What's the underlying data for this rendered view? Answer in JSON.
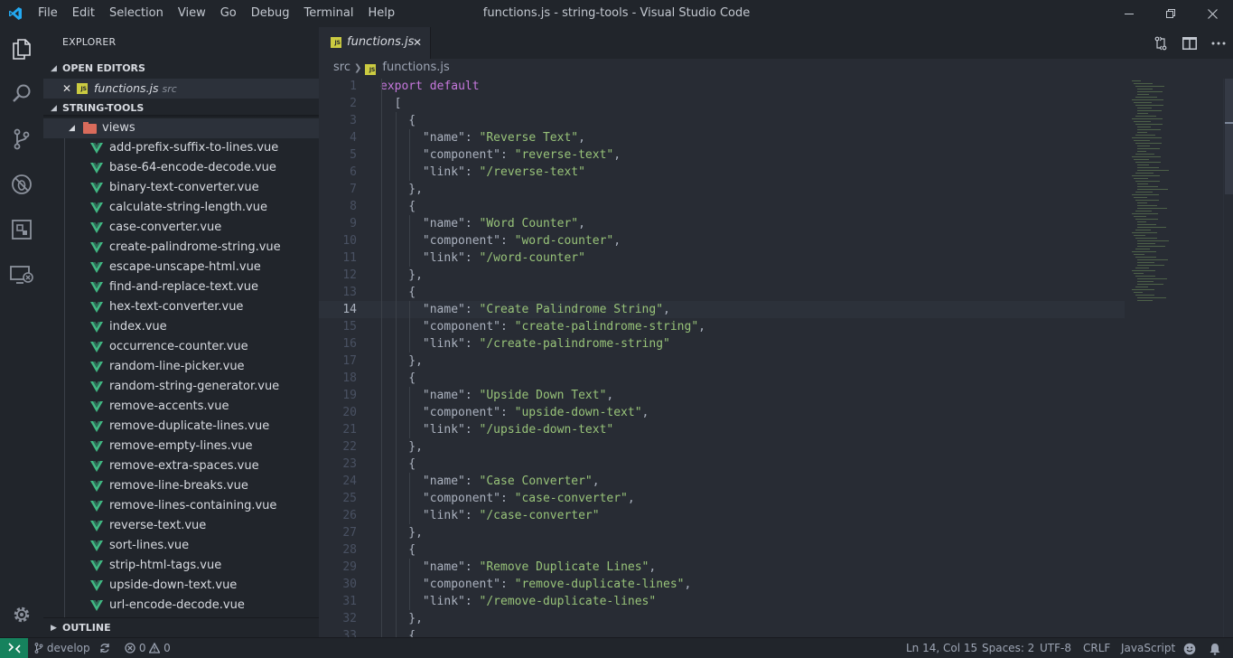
{
  "window": {
    "title": "functions.js - string-tools - Visual Studio Code",
    "menu": [
      "File",
      "Edit",
      "Selection",
      "View",
      "Go",
      "Debug",
      "Terminal",
      "Help"
    ]
  },
  "activity_bar": {
    "items": [
      "explorer-icon",
      "search-icon",
      "source-control-icon",
      "debug-icon",
      "extensions-icon",
      "remote-explorer-icon"
    ],
    "bottom": "settings-gear-icon"
  },
  "sidebar": {
    "title": "EXPLORER",
    "open_editors": {
      "header": "OPEN EDITORS",
      "items": [
        {
          "name": "functions.js",
          "path": "src"
        }
      ]
    },
    "project": {
      "header": "STRING-TOOLS",
      "folder": "views",
      "files": [
        "add-prefix-suffix-to-lines.vue",
        "base-64-encode-decode.vue",
        "binary-text-converter.vue",
        "calculate-string-length.vue",
        "case-converter.vue",
        "create-palindrome-string.vue",
        "escape-unscape-html.vue",
        "find-and-replace-text.vue",
        "hex-text-converter.vue",
        "index.vue",
        "occurrence-counter.vue",
        "random-line-picker.vue",
        "random-string-generator.vue",
        "remove-accents.vue",
        "remove-duplicate-lines.vue",
        "remove-empty-lines.vue",
        "remove-extra-spaces.vue",
        "remove-line-breaks.vue",
        "remove-lines-containing.vue",
        "reverse-text.vue",
        "sort-lines.vue",
        "strip-html-tags.vue",
        "upside-down-text.vue",
        "url-encode-decode.vue"
      ]
    },
    "outline_header": "OUTLINE"
  },
  "editor": {
    "tab": {
      "label": "functions.js",
      "badge": "JS"
    },
    "breadcrumb": [
      "src",
      "functions.js"
    ],
    "current_line": 14,
    "lines": [
      {
        "n": "1",
        "indent": 0,
        "tokens": [
          {
            "t": "kw",
            "v": "export default"
          }
        ]
      },
      {
        "n": "2",
        "indent": 1,
        "tokens": [
          {
            "t": "p",
            "v": "["
          }
        ]
      },
      {
        "n": "3",
        "indent": 2,
        "tokens": [
          {
            "t": "p",
            "v": "{"
          }
        ]
      },
      {
        "n": "4",
        "indent": 3,
        "tokens": [
          {
            "t": "p",
            "v": "\"name\": "
          },
          {
            "t": "s",
            "v": "\"Reverse Text\""
          },
          {
            "t": "p",
            "v": ","
          }
        ]
      },
      {
        "n": "5",
        "indent": 3,
        "tokens": [
          {
            "t": "p",
            "v": "\"component\": "
          },
          {
            "t": "s",
            "v": "\"reverse-text\""
          },
          {
            "t": "p",
            "v": ","
          }
        ]
      },
      {
        "n": "6",
        "indent": 3,
        "tokens": [
          {
            "t": "p",
            "v": "\"link\": "
          },
          {
            "t": "s",
            "v": "\"/reverse-text\""
          }
        ]
      },
      {
        "n": "7",
        "indent": 2,
        "tokens": [
          {
            "t": "p",
            "v": "},"
          }
        ]
      },
      {
        "n": "8",
        "indent": 2,
        "tokens": [
          {
            "t": "p",
            "v": "{"
          }
        ]
      },
      {
        "n": "9",
        "indent": 3,
        "tokens": [
          {
            "t": "p",
            "v": "\"name\": "
          },
          {
            "t": "s",
            "v": "\"Word Counter\""
          },
          {
            "t": "p",
            "v": ","
          }
        ]
      },
      {
        "n": "10",
        "indent": 3,
        "tokens": [
          {
            "t": "p",
            "v": "\"component\": "
          },
          {
            "t": "s",
            "v": "\"word-counter\""
          },
          {
            "t": "p",
            "v": ","
          }
        ]
      },
      {
        "n": "11",
        "indent": 3,
        "tokens": [
          {
            "t": "p",
            "v": "\"link\": "
          },
          {
            "t": "s",
            "v": "\"/word-counter\""
          }
        ]
      },
      {
        "n": "12",
        "indent": 2,
        "tokens": [
          {
            "t": "p",
            "v": "},"
          }
        ]
      },
      {
        "n": "13",
        "indent": 2,
        "tokens": [
          {
            "t": "p",
            "v": "{"
          }
        ]
      },
      {
        "n": "14",
        "indent": 3,
        "tokens": [
          {
            "t": "p",
            "v": "\"name\": "
          },
          {
            "t": "s",
            "v": "\"Create Palindrome String\""
          },
          {
            "t": "p",
            "v": ","
          }
        ]
      },
      {
        "n": "15",
        "indent": 3,
        "tokens": [
          {
            "t": "p",
            "v": "\"component\": "
          },
          {
            "t": "s",
            "v": "\"create-palindrome-string\""
          },
          {
            "t": "p",
            "v": ","
          }
        ]
      },
      {
        "n": "16",
        "indent": 3,
        "tokens": [
          {
            "t": "p",
            "v": "\"link\": "
          },
          {
            "t": "s",
            "v": "\"/create-palindrome-string\""
          }
        ]
      },
      {
        "n": "17",
        "indent": 2,
        "tokens": [
          {
            "t": "p",
            "v": "},"
          }
        ]
      },
      {
        "n": "18",
        "indent": 2,
        "tokens": [
          {
            "t": "p",
            "v": "{"
          }
        ]
      },
      {
        "n": "19",
        "indent": 3,
        "tokens": [
          {
            "t": "p",
            "v": "\"name\": "
          },
          {
            "t": "s",
            "v": "\"Upside Down Text\""
          },
          {
            "t": "p",
            "v": ","
          }
        ]
      },
      {
        "n": "20",
        "indent": 3,
        "tokens": [
          {
            "t": "p",
            "v": "\"component\": "
          },
          {
            "t": "s",
            "v": "\"upside-down-text\""
          },
          {
            "t": "p",
            "v": ","
          }
        ]
      },
      {
        "n": "21",
        "indent": 3,
        "tokens": [
          {
            "t": "p",
            "v": "\"link\": "
          },
          {
            "t": "s",
            "v": "\"/upside-down-text\""
          }
        ]
      },
      {
        "n": "22",
        "indent": 2,
        "tokens": [
          {
            "t": "p",
            "v": "},"
          }
        ]
      },
      {
        "n": "23",
        "indent": 2,
        "tokens": [
          {
            "t": "p",
            "v": "{"
          }
        ]
      },
      {
        "n": "24",
        "indent": 3,
        "tokens": [
          {
            "t": "p",
            "v": "\"name\": "
          },
          {
            "t": "s",
            "v": "\"Case Converter\""
          },
          {
            "t": "p",
            "v": ","
          }
        ]
      },
      {
        "n": "25",
        "indent": 3,
        "tokens": [
          {
            "t": "p",
            "v": "\"component\": "
          },
          {
            "t": "s",
            "v": "\"case-converter\""
          },
          {
            "t": "p",
            "v": ","
          }
        ]
      },
      {
        "n": "26",
        "indent": 3,
        "tokens": [
          {
            "t": "p",
            "v": "\"link\": "
          },
          {
            "t": "s",
            "v": "\"/case-converter\""
          }
        ]
      },
      {
        "n": "27",
        "indent": 2,
        "tokens": [
          {
            "t": "p",
            "v": "},"
          }
        ]
      },
      {
        "n": "28",
        "indent": 2,
        "tokens": [
          {
            "t": "p",
            "v": "{"
          }
        ]
      },
      {
        "n": "29",
        "indent": 3,
        "tokens": [
          {
            "t": "p",
            "v": "\"name\": "
          },
          {
            "t": "s",
            "v": "\"Remove Duplicate Lines\""
          },
          {
            "t": "p",
            "v": ","
          }
        ]
      },
      {
        "n": "30",
        "indent": 3,
        "tokens": [
          {
            "t": "p",
            "v": "\"component\": "
          },
          {
            "t": "s",
            "v": "\"remove-duplicate-lines\""
          },
          {
            "t": "p",
            "v": ","
          }
        ]
      },
      {
        "n": "31",
        "indent": 3,
        "tokens": [
          {
            "t": "p",
            "v": "\"link\": "
          },
          {
            "t": "s",
            "v": "\"/remove-duplicate-lines\""
          }
        ]
      },
      {
        "n": "32",
        "indent": 2,
        "tokens": [
          {
            "t": "p",
            "v": "},"
          }
        ]
      },
      {
        "n": "33",
        "indent": 2,
        "tokens": [
          {
            "t": "p",
            "v": "{"
          }
        ]
      }
    ]
  },
  "status_bar": {
    "branch": "develop",
    "errors": "0",
    "warnings": "0",
    "position": "Ln 14, Col 15",
    "spaces": "Spaces: 2",
    "encoding": "UTF-8",
    "eol": "CRLF",
    "language": "JavaScript"
  },
  "colors": {
    "keyword": "#c678dd",
    "string": "#98c379",
    "remote_accent": "#16825d",
    "vue_icon": "#41b883",
    "js_badge": "#cbcb41",
    "folder_icon": "#d96b5b"
  }
}
